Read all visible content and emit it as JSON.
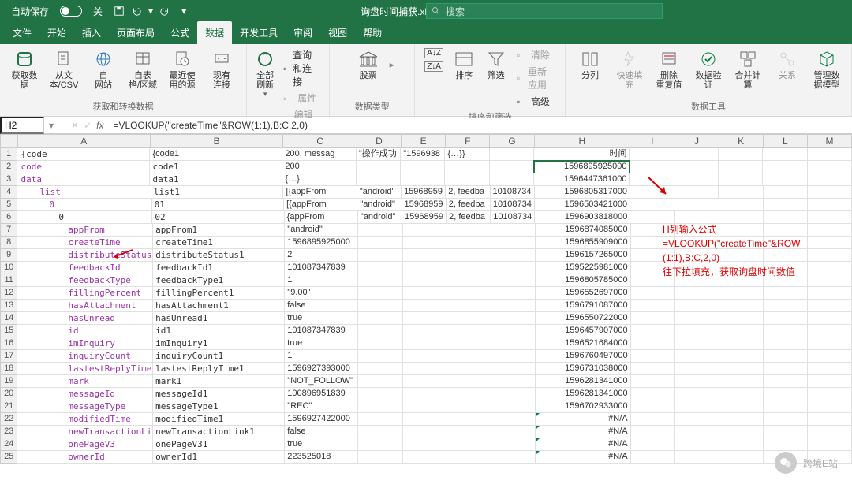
{
  "titlebar": {
    "autosave": "自动保存",
    "off": "关",
    "filename": "询盘时间捕获.xlsx •",
    "search_placeholder": "搜索"
  },
  "tabs": [
    "文件",
    "开始",
    "插入",
    "页面布局",
    "公式",
    "数据",
    "开发工具",
    "审阅",
    "视图",
    "帮助"
  ],
  "active_tab": 5,
  "ribbon": {
    "g1": {
      "label": "获取和转换数据",
      "btns": [
        {
          "l1": "获取数",
          "l2": "据",
          "icon": "db"
        },
        {
          "l1": "从文",
          "l2": "本/CSV",
          "icon": "file"
        },
        {
          "l1": "自",
          "l2": "网站",
          "icon": "web"
        },
        {
          "l1": "自表",
          "l2": "格/区域",
          "icon": "table"
        },
        {
          "l1": "最近使",
          "l2": "用的源",
          "icon": "recent"
        },
        {
          "l1": "现有",
          "l2": "连接",
          "icon": "conn"
        }
      ]
    },
    "g2": {
      "label": "查询和连接",
      "big": {
        "l1": "全部刷新",
        "icon": "refresh"
      },
      "small": [
        {
          "t": "查询和连接",
          "en": true
        },
        {
          "t": "属性",
          "en": false
        },
        {
          "t": "编辑链接",
          "en": false
        }
      ]
    },
    "g3": {
      "label": "数据类型",
      "big": {
        "l1": "股票",
        "icon": "stocks"
      }
    },
    "g4": {
      "label": "排序和筛选",
      "btns": [
        {
          "l1": "",
          "icon": "az"
        },
        {
          "l1": "",
          "icon": "za"
        },
        {
          "l1": "排序",
          "icon": "sort"
        },
        {
          "l1": "筛选",
          "icon": "filter"
        }
      ],
      "small": [
        {
          "t": "清除",
          "en": false
        },
        {
          "t": "重新应用",
          "en": false
        },
        {
          "t": "高级",
          "en": true
        }
      ]
    },
    "g5": {
      "label": "数据工具",
      "btns": [
        {
          "l1": "分列",
          "icon": "textcol"
        },
        {
          "l1": "快速填充",
          "icon": "flash",
          "en": false
        },
        {
          "l1": "删除",
          "l2": "重复值",
          "icon": "dedup"
        },
        {
          "l1": "数据验",
          "l2": "证",
          "icon": "valid"
        },
        {
          "l1": "合并计算",
          "icon": "consol"
        },
        {
          "l1": "关系",
          "icon": "rel",
          "en": false
        },
        {
          "l1": "管理数",
          "l2": "据模型",
          "icon": "model"
        }
      ]
    }
  },
  "namebox": "H2",
  "formula": "=VLOOKUP(\"createTime\"&ROW(1:1),B:C,2,0)",
  "cols": [
    "A",
    "B",
    "C",
    "D",
    "E",
    "F",
    "G",
    "H",
    "I",
    "J",
    "K",
    "L",
    "M"
  ],
  "rows": [
    {
      "n": 1,
      "A": "{code",
      "B": "{code1",
      "C": "200, messag",
      "D": "\"操作成功",
      "E": "\"1596938",
      "F": "{…}}",
      "H": "时间"
    },
    {
      "n": 2,
      "A": "code",
      "Ap": true,
      "B": "code1",
      "Bm": true,
      "C": "200",
      "H": "1596895925000",
      "sel": true
    },
    {
      "n": 3,
      "A": "data",
      "Ap": true,
      "B": "data1",
      "Bm": true,
      "C": "{…}",
      "H": "1596447361000"
    },
    {
      "n": 4,
      "A": "list",
      "Ap": true,
      "Ai": 2,
      "B": "list1",
      "Bm": true,
      "C": "[{appFrom",
      "D": "\"android\"",
      "E": "15968959",
      "F": "2, feedba",
      "G": "10108734",
      "H": "1596805317000"
    },
    {
      "n": 5,
      "A": "0",
      "Ap": true,
      "Ai": 3,
      "B": "01",
      "Bm": true,
      "C": "[{appFrom",
      "D": "\"android\"",
      "E": "15968959",
      "F": "2, feedba",
      "G": "10108734",
      "H": "1596503421000"
    },
    {
      "n": 6,
      "A": "0",
      "Ai": 4,
      "B": "02",
      "Bm": true,
      "C": "{appFrom",
      "D": "\"android\"",
      "E": "15968959",
      "F": "2, feedba",
      "G": "10108734",
      "H": "1596903818000"
    },
    {
      "n": 7,
      "A": "appFrom",
      "Ap": true,
      "Ai": 5,
      "B": "appFrom1",
      "Bm": true,
      "C": "\"android\"",
      "H": "1596874085000"
    },
    {
      "n": 8,
      "A": "createTime",
      "Ap": true,
      "Ai": 5,
      "B": "createTime1",
      "Bm": true,
      "C": "1596895925000",
      "H": "1596855909000",
      "arrow": true
    },
    {
      "n": 9,
      "A": "distributeStatus",
      "Ap": true,
      "Ai": 5,
      "B": "distributeStatus1",
      "Bm": true,
      "C": "2",
      "H": "1596157265000"
    },
    {
      "n": 10,
      "A": "feedbackId",
      "Ap": true,
      "Ai": 5,
      "B": "feedbackId1",
      "Bm": true,
      "C": "101087347839",
      "H": "1595225981000"
    },
    {
      "n": 11,
      "A": "feedbackType",
      "Ap": true,
      "Ai": 5,
      "B": "feedbackType1",
      "Bm": true,
      "C": "1",
      "H": "1596805785000"
    },
    {
      "n": 12,
      "A": "fillingPercent",
      "Ap": true,
      "Ai": 5,
      "B": "fillingPercent1",
      "Bm": true,
      "C": "\"9.00\"",
      "H": "1596552697000"
    },
    {
      "n": 13,
      "A": "hasAttachment",
      "Ap": true,
      "Ai": 5,
      "B": "hasAttachment1",
      "Bm": true,
      "C": "false",
      "H": "1596791087000"
    },
    {
      "n": 14,
      "A": "hasUnread",
      "Ap": true,
      "Ai": 5,
      "B": "hasUnread1",
      "Bm": true,
      "C": "true",
      "H": "1596550722000"
    },
    {
      "n": 15,
      "A": "id",
      "Ap": true,
      "Ai": 5,
      "B": "id1",
      "Bm": true,
      "C": "101087347839",
      "H": "1596457907000"
    },
    {
      "n": 16,
      "A": "imInquiry",
      "Ap": true,
      "Ai": 5,
      "B": "imInquiry1",
      "Bm": true,
      "C": "true",
      "H": "1596521684000"
    },
    {
      "n": 17,
      "A": "inquiryCount",
      "Ap": true,
      "Ai": 5,
      "B": "inquiryCount1",
      "Bm": true,
      "C": "1",
      "H": "1596760497000"
    },
    {
      "n": 18,
      "A": "lastestReplyTime",
      "Ap": true,
      "Ai": 5,
      "B": "lastestReplyTime1",
      "Bm": true,
      "C": "1596927393000",
      "H": "1596731038000"
    },
    {
      "n": 19,
      "A": "mark",
      "Ap": true,
      "Ai": 5,
      "B": "mark1",
      "Bm": true,
      "C": "\"NOT_FOLLOW\"",
      "H": "1596281341000"
    },
    {
      "n": 20,
      "A": "messageId",
      "Ap": true,
      "Ai": 5,
      "B": "messageId1",
      "Bm": true,
      "C": "100896951839",
      "H": "1596281341000"
    },
    {
      "n": 21,
      "A": "messageType",
      "Ap": true,
      "Ai": 5,
      "B": "messageType1",
      "Bm": true,
      "C": "\"REC\"",
      "H": "1596702933000"
    },
    {
      "n": 22,
      "A": "modifiedTime",
      "Ap": true,
      "Ai": 5,
      "B": "modifiedTime1",
      "Bm": true,
      "C": "1596927422000",
      "H": "#N/A",
      "na": true
    },
    {
      "n": 23,
      "A": "newTransactionLink",
      "Ap": true,
      "Ai": 5,
      "B": "newTransactionLink1",
      "Bm": true,
      "C": "false",
      "H": "#N/A",
      "na": true
    },
    {
      "n": 24,
      "A": "onePageV3",
      "Ap": true,
      "Ai": 5,
      "B": "onePageV31",
      "Bm": true,
      "C": "true",
      "H": "#N/A",
      "na": true
    },
    {
      "n": 25,
      "A": "ownerId",
      "Ap": true,
      "Ai": 5,
      "B": "ownerId1",
      "Bm": true,
      "C": "223525018",
      "H": "#N/A",
      "na": true
    }
  ],
  "annotation": {
    "line1": "H列输入公式",
    "line2": "=VLOOKUP(\"createTime\"&ROW",
    "line3": "(1:1),B:C,2,0)",
    "line4": "往下拉填充，获取询盘时间数值"
  },
  "watermark": "跨境E站"
}
